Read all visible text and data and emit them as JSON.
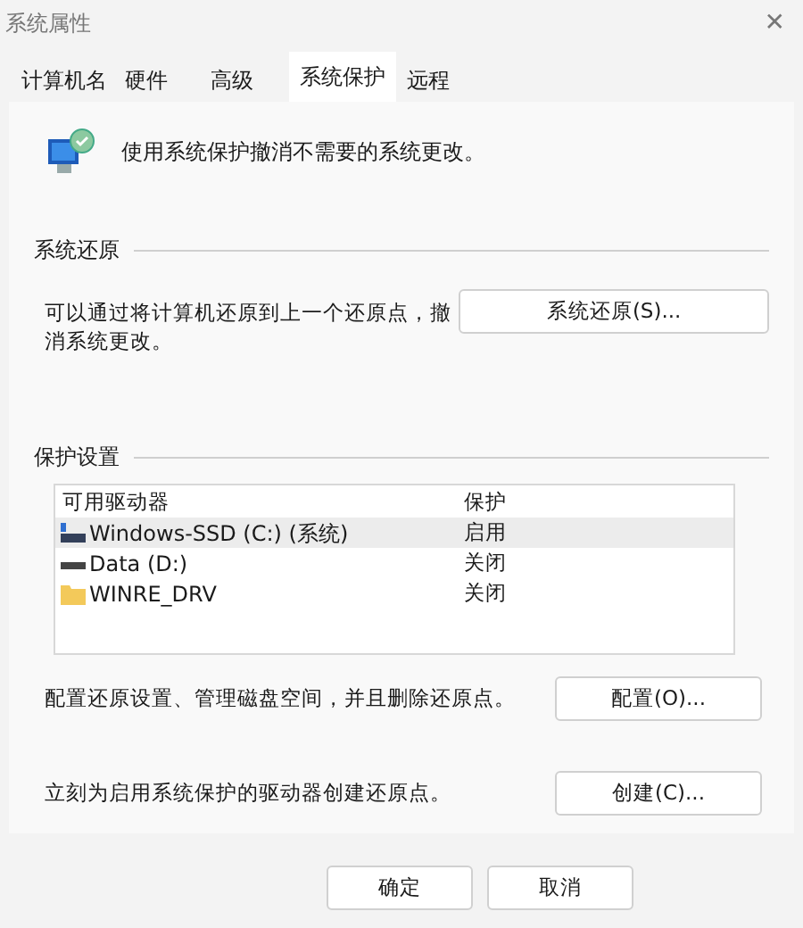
{
  "window": {
    "title": "系统属性",
    "close": "✕"
  },
  "tabs": [
    {
      "label": "计算机名",
      "selected": false
    },
    {
      "label": "硬件",
      "selected": false
    },
    {
      "label": "高级",
      "selected": false
    },
    {
      "label": "系统保护",
      "selected": true
    },
    {
      "label": "远程",
      "selected": false
    }
  ],
  "intro": "使用系统保护撤消不需要的系统更改。",
  "restore": {
    "heading": "系统还原",
    "text": "可以通过将计算机还原到上一个还原点，撤消系统更改。",
    "button": "系统还原(S)..."
  },
  "protection": {
    "heading": "保护设置",
    "columns": [
      "可用驱动器",
      "保护"
    ],
    "rows": [
      {
        "kind": "system",
        "name": "Windows-SSD (C:) (系统)",
        "status": "启用",
        "selected": true
      },
      {
        "kind": "drive",
        "name": "Data (D:)",
        "status": "关闭",
        "selected": false
      },
      {
        "kind": "folder",
        "name": "WINRE_DRV",
        "status": "关闭",
        "selected": false
      }
    ],
    "configure_text": "配置还原设置、管理磁盘空间，并且删除还原点。",
    "configure_button": "配置(O)...",
    "create_text": "立刻为启用系统保护的驱动器创建还原点。",
    "create_button": "创建(C)..."
  },
  "buttons": [
    "确定",
    "取消"
  ]
}
